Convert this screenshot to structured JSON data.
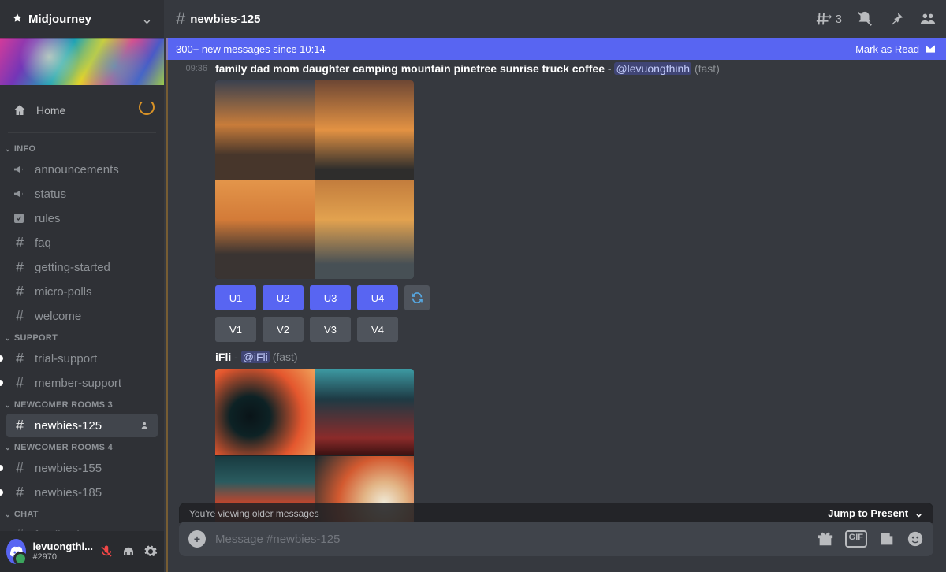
{
  "server": {
    "name": "Midjourney"
  },
  "sidebar": {
    "home": "Home",
    "sections": [
      {
        "label": "INFO",
        "items": [
          {
            "icon": "megaphone",
            "label": "announcements"
          },
          {
            "icon": "megaphone",
            "label": "status"
          },
          {
            "icon": "check",
            "label": "rules"
          },
          {
            "icon": "hash",
            "label": "faq"
          },
          {
            "icon": "hash",
            "label": "getting-started"
          },
          {
            "icon": "hash",
            "label": "micro-polls"
          },
          {
            "icon": "hash",
            "label": "welcome"
          }
        ]
      },
      {
        "label": "SUPPORT",
        "items": [
          {
            "icon": "hash",
            "label": "trial-support",
            "pip": true
          },
          {
            "icon": "hash",
            "label": "member-support",
            "pip": true
          }
        ]
      },
      {
        "label": "NEWCOMER ROOMS 3",
        "items": [
          {
            "icon": "hash",
            "label": "newbies-125",
            "active": true,
            "extra": "person-add"
          }
        ]
      },
      {
        "label": "NEWCOMER ROOMS 4",
        "items": [
          {
            "icon": "hash",
            "label": "newbies-155",
            "pip": true
          },
          {
            "icon": "hash",
            "label": "newbies-185",
            "pip": true
          }
        ]
      },
      {
        "label": "CHAT",
        "items": [
          {
            "icon": "hash",
            "label": "feedback",
            "pip": true,
            "cut": true
          }
        ]
      }
    ]
  },
  "user": {
    "name": "levuongthi...",
    "tag": "#2970"
  },
  "channel": {
    "name": "newbies-125"
  },
  "topbar": {
    "threads_count": "3"
  },
  "new_banner": {
    "text": "300+ new messages since 10:14",
    "mark": "Mark as Read"
  },
  "messages": {
    "m1": {
      "time": "09:36",
      "prompt": "family dad mom daughter camping mountain pinetree sunrise truck coffee",
      "mention": "@levuongthinh",
      "mode": "(fast)"
    },
    "m2": {
      "prompt": "iFli",
      "mention": "@iFli",
      "mode": "(fast)"
    }
  },
  "buttons": {
    "u": [
      "U1",
      "U2",
      "U3",
      "U4"
    ],
    "v": [
      "V1",
      "V2",
      "V3",
      "V4"
    ]
  },
  "older_bar": {
    "text": "You're viewing older messages",
    "jump": "Jump to Present"
  },
  "composer": {
    "placeholder": "Message #newbies-125"
  }
}
